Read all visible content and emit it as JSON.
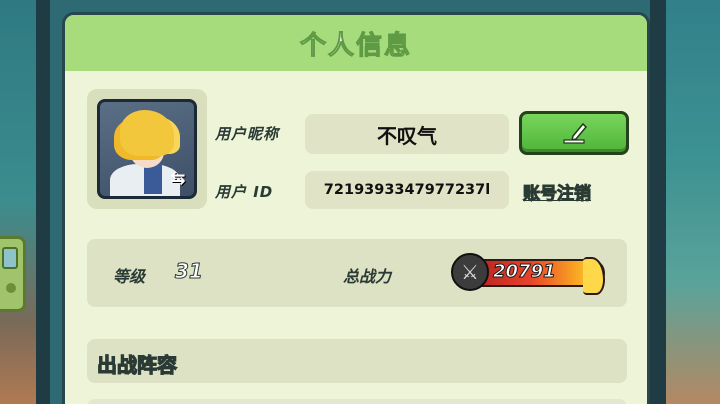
{
  "panel": {
    "title": "个人信息"
  },
  "profile": {
    "nickname_label": "用户昵称",
    "nickname_value": "不叹气",
    "id_label": "用户 ID",
    "id_value": "7219393347977237l",
    "cancel_account_label": "账号注销",
    "edit_icon": "pencil-icon",
    "swap_icon": "swap-arrows-icon"
  },
  "stats": {
    "level_label": "等级",
    "level_value": "31",
    "power_label": "总战力",
    "power_value": "20791",
    "power_icon": "crossed-swords-icon"
  },
  "lineup": {
    "title": "出战阵容"
  },
  "colors": {
    "header": "#a6dc7c",
    "panel_bg": "#eef4d8",
    "edit_button": "#5cc244"
  }
}
